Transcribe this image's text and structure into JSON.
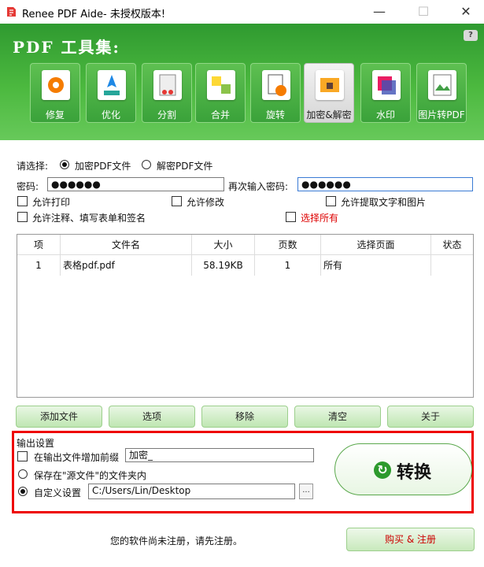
{
  "window": {
    "title": "Renee PDF Aide- 未授权版本!",
    "minimize": "—",
    "maximize": "☐",
    "close": "✕"
  },
  "header": {
    "title": "PDF 工具集:",
    "help": "?"
  },
  "tools": [
    {
      "label": "修复",
      "icon": "repair-icon"
    },
    {
      "label": "优化",
      "icon": "optimize-icon"
    },
    {
      "label": "分割",
      "icon": "split-icon"
    },
    {
      "label": "合并",
      "icon": "merge-icon"
    },
    {
      "label": "旋转",
      "icon": "rotate-icon"
    },
    {
      "label": "加密&解密",
      "icon": "encrypt-icon",
      "active": true
    },
    {
      "label": "水印",
      "icon": "watermark-icon"
    },
    {
      "label": "图片转PDF",
      "icon": "image-to-pdf-icon"
    }
  ],
  "form": {
    "select_label": "请选择:",
    "encrypt_option": "加密PDF文件",
    "decrypt_option": "解密PDF文件",
    "password_label": "密码:",
    "password_value": "●●●●●●",
    "confirm_label": "再次输入密码:",
    "confirm_value": "●●●●●●",
    "allow_print": "允许打印",
    "allow_modify": "允许修改",
    "allow_extract": "允许提取文字和图片",
    "allow_annotate": "允许注释、填写表单和签名",
    "select_all": "选择所有"
  },
  "table": {
    "headers": [
      "项",
      "文件名",
      "大小",
      "页数",
      "选择页面",
      "状态"
    ],
    "rows": [
      [
        "1",
        "表格pdf.pdf",
        "58.19KB",
        "1",
        "所有",
        ""
      ]
    ]
  },
  "actions": {
    "add": "添加文件",
    "options": "选项",
    "remove": "移除",
    "clear": "清空",
    "about": "关于"
  },
  "output": {
    "title": "输出设置",
    "prefix_label": "在输出文件增加前缀",
    "prefix_value": "加密_",
    "source_folder": "保存在\"源文件\"的文件夹内",
    "custom_label": "自定义设置",
    "custom_path": "C:/Users/Lin/Desktop",
    "browse": "...",
    "convert": "转换",
    "convert_icon": "↻"
  },
  "footer": {
    "notice": "您的软件尚未注册，请先注册。",
    "register": "购买 & 注册"
  },
  "colors": {
    "header_green": "#4cb93f",
    "highlight_red": "#e00000"
  }
}
